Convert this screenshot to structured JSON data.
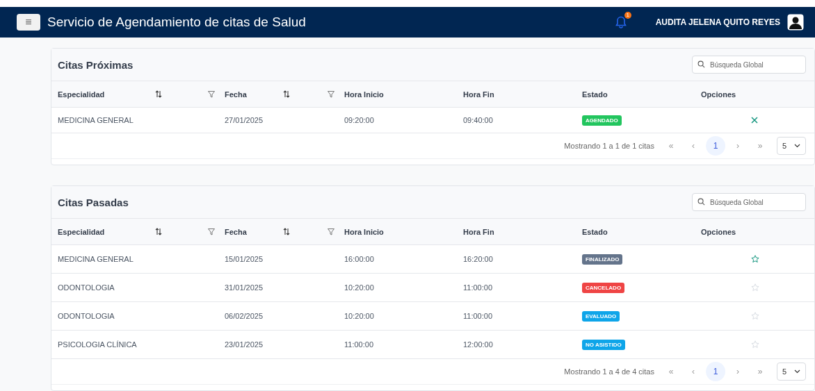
{
  "navbar": {
    "menu_button": "≡",
    "title": "Servicio de Agendamiento de citas de Salud",
    "notification_count": "1",
    "user_name": "AUDITA JELENA QUITO REYES"
  },
  "panels": [
    {
      "title": "Citas Próximas",
      "search": {
        "placeholder": "Búsqueda Global"
      },
      "columns": [
        {
          "label": "Especialidad",
          "sortable": true,
          "filterable": true
        },
        {
          "label": "Fecha",
          "sortable": true,
          "filterable": true
        },
        {
          "label": "Hora Inicio",
          "sortable": false,
          "filterable": false
        },
        {
          "label": "Hora Fin",
          "sortable": false,
          "filterable": false
        },
        {
          "label": "Estado",
          "sortable": false,
          "filterable": false
        },
        {
          "label": "Opciones",
          "sortable": false,
          "filterable": false
        }
      ],
      "rows": [
        {
          "especialidad": "MEDICINA GENERAL",
          "fecha": "27/01/2025",
          "hora_inicio": "09:20:00",
          "hora_fin": "09:40:00",
          "estado": {
            "label": "AGENDADO",
            "color": "#22c55e"
          },
          "option": {
            "kind": "cancel",
            "active": true
          }
        }
      ],
      "pagination": {
        "summary": "Mostrando 1 a 1 de 1 citas",
        "first": "«",
        "prev": "‹",
        "pages": [
          {
            "label": "1",
            "selected": true
          }
        ],
        "next": "›",
        "last": "»",
        "page_size": "5"
      }
    },
    {
      "title": "Citas Pasadas",
      "search": {
        "placeholder": "Búsqueda Global"
      },
      "columns": [
        {
          "label": "Especialidad",
          "sortable": true,
          "filterable": true
        },
        {
          "label": "Fecha",
          "sortable": true,
          "filterable": true
        },
        {
          "label": "Hora Inicio",
          "sortable": false,
          "filterable": false
        },
        {
          "label": "Hora Fin",
          "sortable": false,
          "filterable": false
        },
        {
          "label": "Estado",
          "sortable": false,
          "filterable": false
        },
        {
          "label": "Opciones",
          "sortable": false,
          "filterable": false
        }
      ],
      "rows": [
        {
          "especialidad": "MEDICINA GENERAL",
          "fecha": "15/01/2025",
          "hora_inicio": "16:00:00",
          "hora_fin": "16:20:00",
          "estado": {
            "label": "FINALIZADO",
            "color": "#64748b"
          },
          "option": {
            "kind": "star",
            "active": true
          }
        },
        {
          "especialidad": "ODONTOLOGIA",
          "fecha": "31/01/2025",
          "hora_inicio": "10:20:00",
          "hora_fin": "11:00:00",
          "estado": {
            "label": "CANCELADO",
            "color": "#ef4444"
          },
          "option": {
            "kind": "star",
            "active": false
          }
        },
        {
          "especialidad": "ODONTOLOGIA",
          "fecha": "06/02/2025",
          "hora_inicio": "10:20:00",
          "hora_fin": "11:00:00",
          "estado": {
            "label": "EVALUADO",
            "color": "#0ea5e9"
          },
          "option": {
            "kind": "star",
            "active": false
          }
        },
        {
          "especialidad": "PSICOLOGIA CLÍNICA",
          "fecha": "23/01/2025",
          "hora_inicio": "11:00:00",
          "hora_fin": "12:00:00",
          "estado": {
            "label": "NO ASISTIDO",
            "color": "#0ea5e9"
          },
          "option": {
            "kind": "star",
            "active": false
          }
        }
      ],
      "pagination": {
        "summary": "Mostrando 1 a 4 de 4 citas",
        "first": "«",
        "prev": "‹",
        "pages": [
          {
            "label": "1",
            "selected": true
          }
        ],
        "next": "›",
        "last": "»",
        "page_size": "5"
      }
    }
  ]
}
